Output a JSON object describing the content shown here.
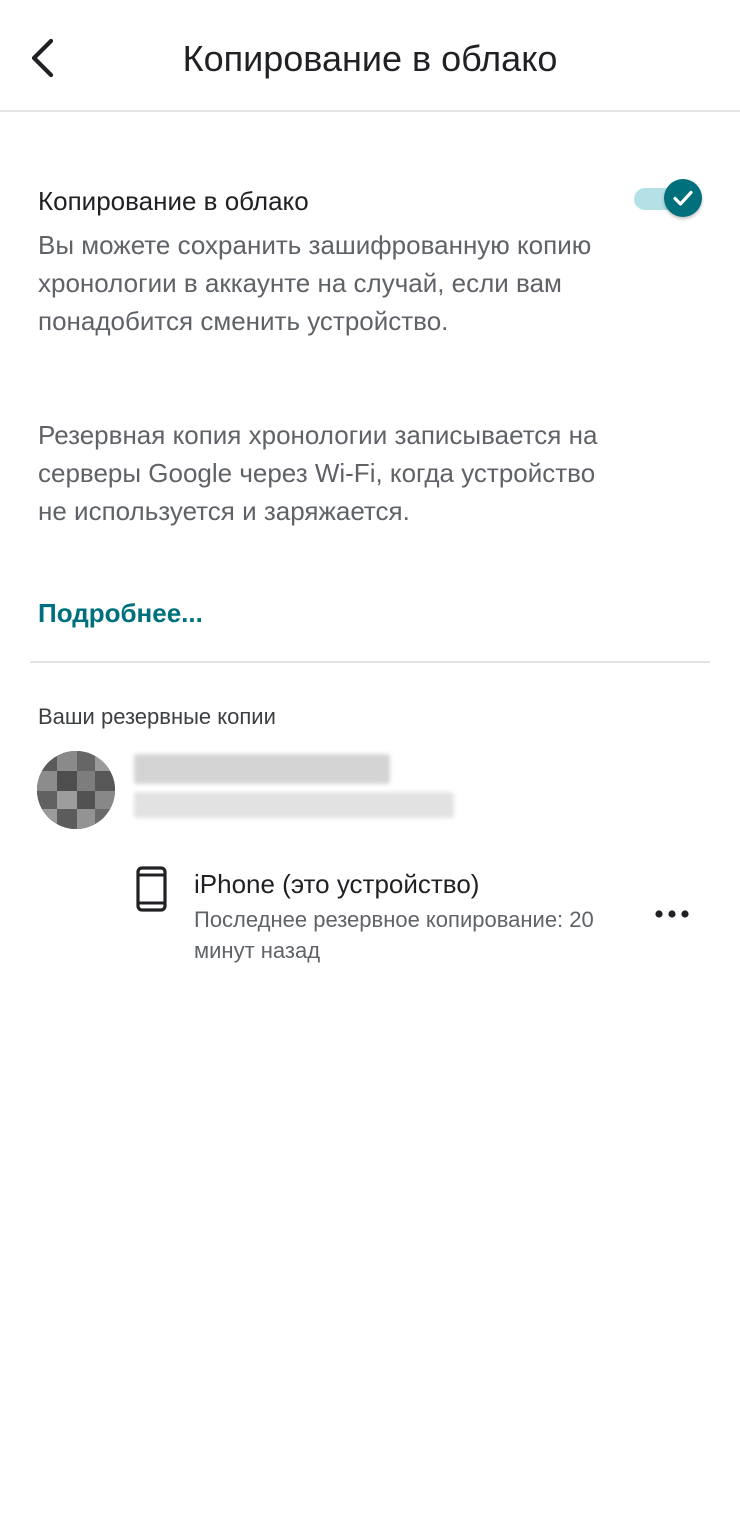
{
  "header": {
    "title": "Копирование в облако",
    "back_icon": "chevron-left-icon"
  },
  "setting": {
    "title": "Копирование в облако",
    "enabled": true,
    "description_1": "Вы можете сохранить зашифрованную копию хронологии в аккаунте на случай, если вам понадобится сменить устройство.",
    "description_2": "Резервная копия хронологии записывается на серверы Google через Wi-Fi, когда устройство не используется и заряжается.",
    "learn_more": "Подробнее..."
  },
  "backups": {
    "section_label": "Ваши резервные копии",
    "devices": [
      {
        "icon": "smartphone-icon",
        "name": "iPhone (это устройство)",
        "status": "Последнее резервное копирование: 20 минут назад",
        "menu_icon": "more-horizontal-icon"
      }
    ]
  },
  "colors": {
    "accent": "#00707c",
    "toggle_track": "#b3e1e6",
    "text_primary": "#202124",
    "text_secondary": "#5f6368",
    "divider": "#e3e3e3"
  }
}
